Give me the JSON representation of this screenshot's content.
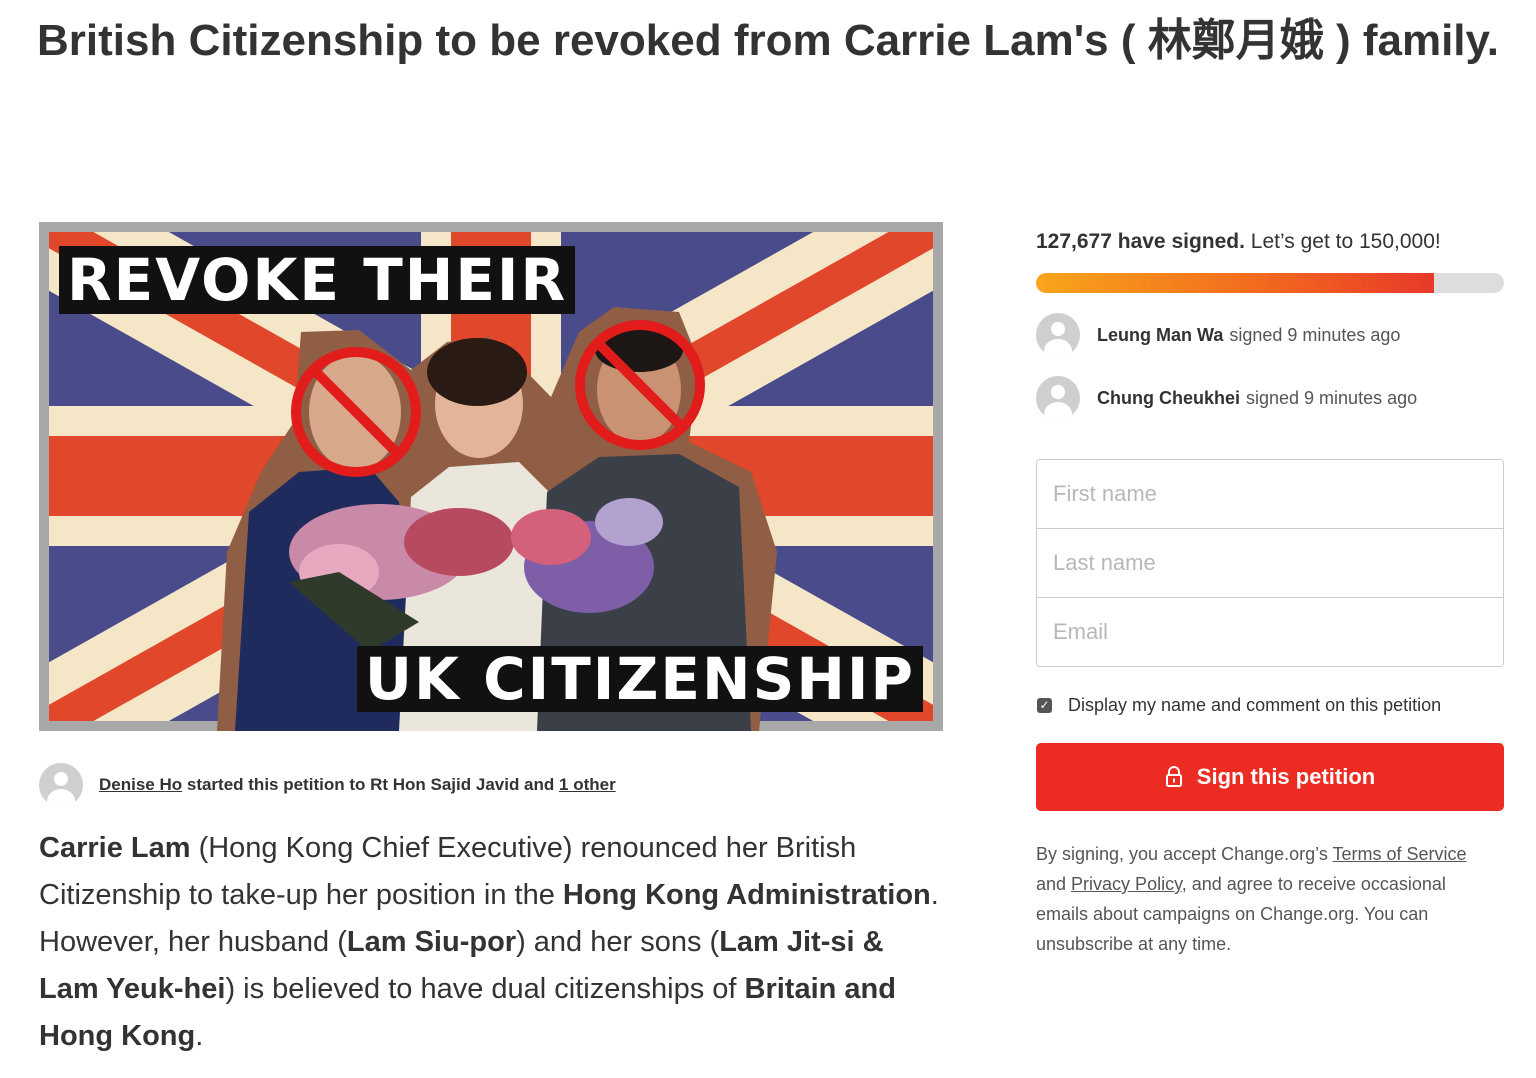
{
  "petition": {
    "title": "British Citizenship to be revoked from Carrie Lam's ( 林鄭月娥 ) family."
  },
  "hero": {
    "banner_top": "REVOKE THEIR",
    "banner_bottom": "UK CITIZENSHIP",
    "colors": {
      "flag_blue": "#4a4b8a",
      "flag_red": "#e0472b",
      "flag_cream": "#f4e6c7",
      "banner_black": "#111111",
      "prohibition_red": "#e21b1b"
    }
  },
  "starter": {
    "name": "Denise Ho",
    "middle": " started this petition to Rt Hon Sajid Javid and ",
    "other_link": "1 other"
  },
  "description": {
    "p1": "Carrie Lam",
    "p2": " (Hong Kong Chief Executive) renounced her British Citizenship to take-up her position in the ",
    "p3": "Hong Kong Administration",
    "p4": ".  However, her husband (",
    "p5": "Lam Siu-por",
    "p6": ") and her sons (",
    "p7": "Lam Jit-si & Lam Yeuk-hei",
    "p8": ") is believed to have dual citizenships of ",
    "p9": "Britain and Hong Kong",
    "p10": "."
  },
  "signatures": {
    "count_text": "127,677 have signed.",
    "goal_text": " Let’s get to 150,000!",
    "progress_fraction": 0.8512,
    "recent": [
      {
        "name": "Leung Man Wa",
        "action": "signed 9 minutes ago"
      },
      {
        "name": "Chung Cheukhei",
        "action": "signed 9 minutes ago"
      }
    ]
  },
  "form": {
    "first_name_placeholder": "First name",
    "last_name_placeholder": "Last name",
    "email_placeholder": "Email",
    "display_label": "Display my name and comment on this petition",
    "display_checked": true,
    "submit_label": "Sign this petition",
    "submit_icon": "lock-icon",
    "accent_color": "#ec2c22"
  },
  "legal": {
    "pre": "By signing, you accept Change.org’s ",
    "terms": "Terms of Service",
    "and": " and ",
    "privacy": "Privacy Policy",
    "post": ", and agree to receive occasional emails about campaigns on Change.org. You can unsubscribe at any time."
  }
}
